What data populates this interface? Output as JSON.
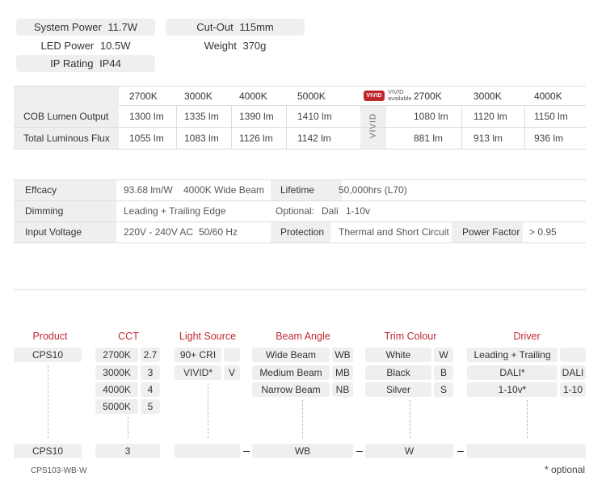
{
  "specs": {
    "system_power": {
      "label": "System Power",
      "value": "11.7W"
    },
    "led_power": {
      "label": "LED Power",
      "value": "10.5W"
    },
    "ip_rating": {
      "label": "IP Rating",
      "value": "IP44"
    },
    "cut_out": {
      "label": "Cut-Out",
      "value": "115mm"
    },
    "weight": {
      "label": "Weight",
      "value": "370g"
    }
  },
  "lumen_table": {
    "headers": [
      "2700K",
      "3000K",
      "4000K",
      "5000K"
    ],
    "vivid_logo": "VIVID",
    "vivid_available": [
      "VIVID",
      "available"
    ],
    "vivid_headers": [
      "2700K",
      "3000K",
      "4000K"
    ],
    "vivid_label": "VIVID",
    "rows": [
      {
        "label": "COB Lumen Output",
        "values": [
          "1300 lm",
          "1335 lm",
          "1390 lm",
          "1410 lm"
        ],
        "vivid": [
          "1080 lm",
          "1120 lm",
          "1150 lm"
        ]
      },
      {
        "label": "Total Luminous Flux",
        "values": [
          "1055 lm",
          "1083 lm",
          "1126 lm",
          "1142 lm"
        ],
        "vivid": [
          "881 lm",
          "913 lm",
          "936 lm"
        ]
      }
    ]
  },
  "params": {
    "efficacy_label": "Effcacy",
    "efficacy_value": "93.68 lm/W",
    "efficacy_note": "4000K Wide Beam",
    "lifetime_label": "Lifetime",
    "lifetime_value": "50,000hrs (L70)",
    "dimming_label": "Dimming",
    "dimming_value": "Leading + Trailing Edge",
    "dimming_optional": "Optional:",
    "dimming_opt1": "Dali",
    "dimming_opt2": "1-10v",
    "input_label": "Input Voltage",
    "input_value": "220V - 240V AC",
    "input_freq": "50/60 Hz",
    "protection_label": "Protection",
    "protection_value": "Thermal and Short Circuit",
    "pf_label": "Power Factor",
    "pf_value": "> 0.95"
  },
  "ordering": {
    "headers": {
      "product": "Product",
      "cct": "CCT",
      "light_source": "Light Source",
      "beam_angle": "Beam Angle",
      "trim_colour": "Trim Colour",
      "driver": "Driver"
    },
    "product": "CPS10",
    "cct": [
      {
        "label": "2700K",
        "code": "2.7"
      },
      {
        "label": "3000K",
        "code": "3"
      },
      {
        "label": "4000K",
        "code": "4"
      },
      {
        "label": "5000K",
        "code": "5"
      }
    ],
    "light_source": [
      {
        "label": "90+ CRI",
        "code": ""
      },
      {
        "label": "VIVID*",
        "code": "V"
      }
    ],
    "beam_angle": [
      {
        "label": "Wide Beam",
        "code": "WB"
      },
      {
        "label": "Medium Beam",
        "code": "MB"
      },
      {
        "label": "Narrow Beam",
        "code": "NB"
      }
    ],
    "trim_colour": [
      {
        "label": "White",
        "code": "W"
      },
      {
        "label": "Black",
        "code": "B"
      },
      {
        "label": "Silver",
        "code": "S"
      }
    ],
    "driver": [
      {
        "label": "Leading + Trailing",
        "code": ""
      },
      {
        "label": "DALI*",
        "code": "DALI"
      },
      {
        "label": "1-10v*",
        "code": "1-10"
      }
    ],
    "result": {
      "product": "CPS10",
      "cct": "3",
      "light_source": "",
      "beam": "WB",
      "trim": "W",
      "driver": ""
    },
    "example_code": "CPS103-WB-W",
    "optional_note": "* optional"
  },
  "colors": {
    "accent_red": "#c0272d",
    "vivid_badge": "#c0272d",
    "pill_grey": "#efefef"
  }
}
